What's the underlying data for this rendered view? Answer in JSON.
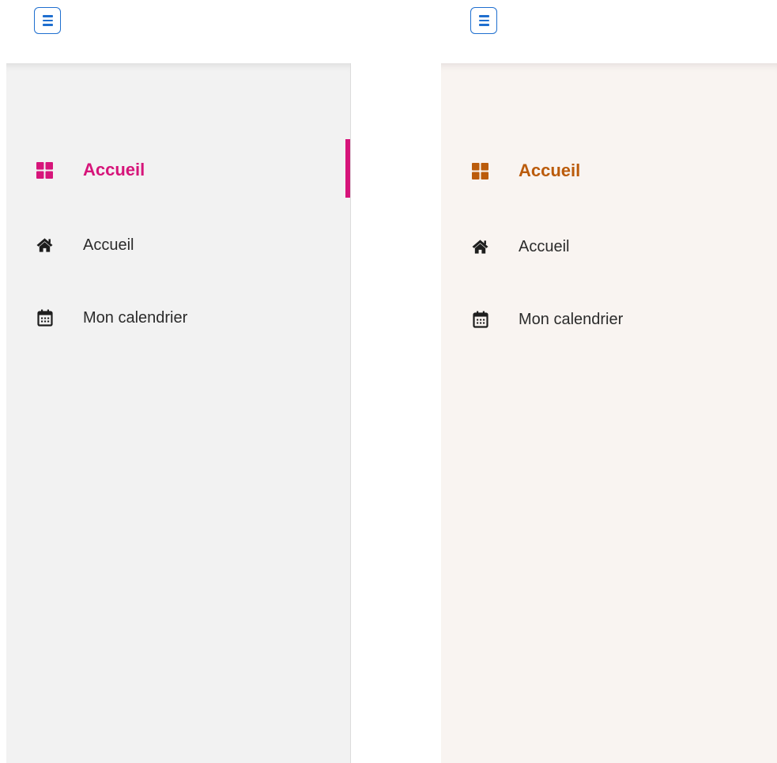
{
  "panels": [
    {
      "theme": "magenta",
      "background_color": "#f2f2f2",
      "accent_color": "#d6157a",
      "menu_button": {
        "icon": "hamburger-icon"
      },
      "nav_items": [
        {
          "label": "Accueil",
          "icon": "dashboard-grid-icon",
          "active": true
        },
        {
          "label": "Accueil",
          "icon": "home-icon",
          "active": false
        },
        {
          "label": "Mon calendrier",
          "icon": "calendar-icon",
          "active": false
        }
      ]
    },
    {
      "theme": "orange",
      "background_color": "#f9f4f1",
      "accent_color": "#bb5b0b",
      "menu_button": {
        "icon": "hamburger-icon"
      },
      "nav_items": [
        {
          "label": "Accueil",
          "icon": "dashboard-grid-icon",
          "active": true
        },
        {
          "label": "Accueil",
          "icon": "home-icon",
          "active": false
        },
        {
          "label": "Mon calendrier",
          "icon": "calendar-icon",
          "active": false
        }
      ]
    }
  ]
}
